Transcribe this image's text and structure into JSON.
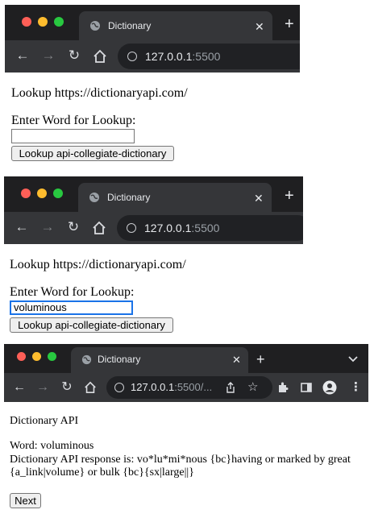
{
  "windows": [
    {
      "tab_title": "Dictionary",
      "address": {
        "host": "127.0.0.1",
        "rest": ":5500"
      },
      "page": {
        "heading": "Lookup https://dictionaryapi.com/",
        "prompt": "Enter Word for Lookup:",
        "input_value": "",
        "button_label": "Lookup api-collegiate-dictionary"
      }
    },
    {
      "tab_title": "Dictionary",
      "address": {
        "host": "127.0.0.1",
        "rest": ":5500"
      },
      "page": {
        "heading": "Lookup https://dictionaryapi.com/",
        "prompt": "Enter Word for Lookup:",
        "input_value": "voluminous",
        "button_label": "Lookup api-collegiate-dictionary"
      }
    },
    {
      "tab_title": "Dictionary",
      "address": {
        "host": "127.0.0.1",
        "rest": ":5500/..."
      },
      "page": {
        "heading": "Dictionary API",
        "word_line": "Word: voluminous",
        "response_line1": "Dictionary API response is: vo*lu*mi*nous {bc}having or marked by great",
        "response_line2": "{a_link|volume} or bulk {bc}{sx|large||}",
        "next_label": "Next"
      }
    }
  ],
  "icons": {
    "back": "arrow-left-icon",
    "forward": "arrow-right-icon",
    "reload": "reload-icon",
    "home": "home-icon",
    "info": "info-icon",
    "globe": "globe-icon",
    "close": "close-icon",
    "new_tab": "plus-icon",
    "share": "share-icon",
    "bookmark": "star-icon",
    "extensions": "puzzle-icon",
    "sidebar": "sidebar-icon",
    "profile": "profile-icon",
    "menu": "kebab-menu-icon",
    "tab_search": "chevron-down-icon"
  }
}
